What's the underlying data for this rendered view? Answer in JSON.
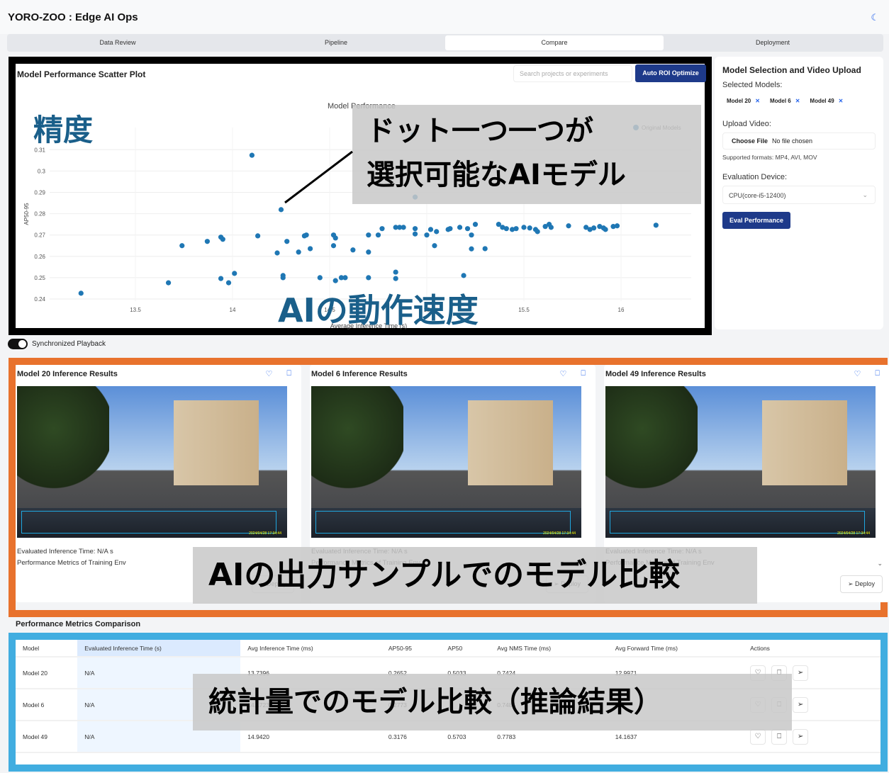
{
  "header": {
    "title": "YORO-ZOO : Edge AI Ops",
    "theme_icon": "moon-icon"
  },
  "tabs": [
    {
      "label": "Data Review"
    },
    {
      "label": "Pipeline"
    },
    {
      "label": "Compare",
      "active": true
    },
    {
      "label": "Deployment"
    }
  ],
  "scatter_panel": {
    "title": "Model Performance Scatter Plot",
    "search_placeholder": "Search projects or experiments",
    "optimize_label": "Auto ROI Optimize"
  },
  "chart_data": {
    "type": "scatter",
    "title": "Model Performance",
    "xlabel": "Average Inference Time (s)",
    "ylabel": "AP50-95",
    "xlim": [
      13.0,
      16.35
    ],
    "ylim": [
      0.236,
      0.322
    ],
    "x_ticks": [
      "13.5",
      "14",
      "14.5",
      "15",
      "15.5",
      "16"
    ],
    "y_ticks": [
      "0.24",
      "0.25",
      "0.26",
      "0.27",
      "0.28",
      "0.29",
      "0.3",
      "0.31"
    ],
    "legend": "Original Models",
    "legend_position": "top-right",
    "color": "#1f77b4",
    "grid": true,
    "points": [
      [
        13.22,
        0.2427
      ],
      [
        13.67,
        0.2476
      ],
      [
        13.74,
        0.265
      ],
      [
        13.87,
        0.267
      ],
      [
        13.94,
        0.269
      ],
      [
        13.95,
        0.268
      ],
      [
        13.94,
        0.2496
      ],
      [
        13.98,
        0.2476
      ],
      [
        14.01,
        0.252
      ],
      [
        14.1,
        0.3074
      ],
      [
        14.13,
        0.2696
      ],
      [
        14.23,
        0.2616
      ],
      [
        14.25,
        0.2819
      ],
      [
        14.26,
        0.251
      ],
      [
        14.26,
        0.25
      ],
      [
        14.28,
        0.267
      ],
      [
        14.34,
        0.262
      ],
      [
        14.37,
        0.2696
      ],
      [
        14.38,
        0.27
      ],
      [
        14.4,
        0.2636
      ],
      [
        14.45,
        0.25
      ],
      [
        14.52,
        0.27
      ],
      [
        14.53,
        0.2686
      ],
      [
        14.52,
        0.265
      ],
      [
        14.53,
        0.2486
      ],
      [
        14.56,
        0.25
      ],
      [
        14.58,
        0.25
      ],
      [
        14.62,
        0.263
      ],
      [
        14.7,
        0.262
      ],
      [
        14.7,
        0.27
      ],
      [
        14.7,
        0.25
      ],
      [
        14.75,
        0.27
      ],
      [
        14.77,
        0.273
      ],
      [
        14.84,
        0.2526
      ],
      [
        14.84,
        0.2496
      ],
      [
        14.84,
        0.2736
      ],
      [
        14.86,
        0.2736
      ],
      [
        14.88,
        0.2736
      ],
      [
        14.94,
        0.2705
      ],
      [
        14.94,
        0.273
      ],
      [
        14.93,
        0.317
      ],
      [
        14.94,
        0.2878
      ],
      [
        15.0,
        0.27
      ],
      [
        15.02,
        0.2726
      ],
      [
        15.05,
        0.2716
      ],
      [
        15.04,
        0.265
      ],
      [
        15.11,
        0.2726
      ],
      [
        15.12,
        0.273
      ],
      [
        15.17,
        0.2736
      ],
      [
        15.21,
        0.273
      ],
      [
        15.19,
        0.251
      ],
      [
        15.23,
        0.27
      ],
      [
        15.23,
        0.2635
      ],
      [
        15.25,
        0.275
      ],
      [
        15.3,
        0.2636
      ],
      [
        15.37,
        0.275
      ],
      [
        15.39,
        0.2736
      ],
      [
        15.41,
        0.273
      ],
      [
        15.44,
        0.2726
      ],
      [
        15.46,
        0.273
      ],
      [
        15.5,
        0.2736
      ],
      [
        15.53,
        0.2733
      ],
      [
        15.56,
        0.2726
      ],
      [
        15.57,
        0.2716
      ],
      [
        15.61,
        0.274
      ],
      [
        15.63,
        0.275
      ],
      [
        15.64,
        0.2736
      ],
      [
        15.73,
        0.2743
      ],
      [
        15.82,
        0.2736
      ],
      [
        15.84,
        0.2726
      ],
      [
        15.86,
        0.2733
      ],
      [
        15.89,
        0.274
      ],
      [
        15.91,
        0.2733
      ],
      [
        15.92,
        0.2726
      ],
      [
        15.96,
        0.274
      ],
      [
        15.98,
        0.2743
      ],
      [
        16.18,
        0.2746
      ]
    ]
  },
  "annotations": {
    "accuracy": "精度",
    "speed": "AIの動作速度",
    "dots": "ドット一つ一つが\n選択可能なAIモデル",
    "samples": "AIの出力サンプルでのモデル比較",
    "stats": "統計量でのモデル比較（推論結果）"
  },
  "side": {
    "title": "Model Selection and Video Upload",
    "selected_label": "Selected Models:",
    "models": [
      "Model 20",
      "Model 6",
      "Model 49"
    ],
    "upload_label": "Upload Video:",
    "choose_file": "Choose File",
    "no_file": "No file chosen",
    "formats": "Supported formats: MP4, AVI, MOV",
    "device_label": "Evaluation Device:",
    "device_value": "CPU(core-i5-12400)",
    "eval_label": "Eval Performance"
  },
  "sync": {
    "label": "Synchronized Playback",
    "on": true
  },
  "cards": [
    {
      "title": "Model 20 Inference Results",
      "eval_time": "Evaluated Inference Time: N/A s",
      "metrics": "Performance Metrics of Training Env",
      "deploy": "Deploy",
      "timestamp": "2024/04/28 17:34:44"
    },
    {
      "title": "Model 6 Inference Results",
      "eval_time": "Evaluated Inference Time: N/A s",
      "metrics": "Performance Metrics of Training Env",
      "deploy": "Deploy",
      "timestamp": "2024/04/28 17:34:44"
    },
    {
      "title": "Model 49 Inference Results",
      "eval_time": "Evaluated Inference Time: N/A s",
      "metrics": "Performance Metrics of Training Env",
      "deploy": "Deploy",
      "timestamp": "2024/04/28 17:34:44"
    }
  ],
  "comparison": {
    "title": "Performance Metrics Comparison",
    "columns": [
      "Model",
      "Evaluated Inference Time (s)",
      "Avg Inference Time (ms)",
      "AP50-95",
      "AP50",
      "Avg NMS Time (ms)",
      "Avg Forward Time (ms)",
      "Actions"
    ],
    "rows": [
      [
        "Model 20",
        "N/A",
        "13.7396",
        "0.2652",
        "0.5033",
        "0.7424",
        "12.9971"
      ],
      [
        "Model 6",
        "N/A",
        "14.1723",
        "0.2773",
        "",
        "0.7485",
        ""
      ],
      [
        "Model 49",
        "N/A",
        "14.9420",
        "0.3176",
        "0.5703",
        "0.7783",
        "14.1637"
      ]
    ]
  }
}
